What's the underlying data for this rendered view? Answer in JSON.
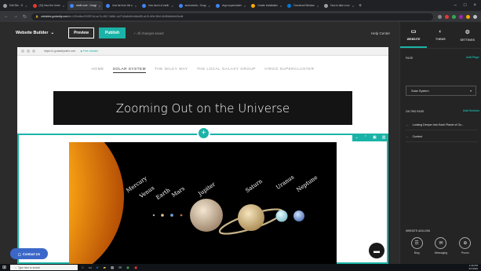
{
  "browser": {
    "tabs": [
      {
        "label": "Edit Site - G",
        "active": false
      },
      {
        "label": "(24) How the Unive",
        "active": false
      },
      {
        "label": "earth core - Googl",
        "active": true
      },
      {
        "label": "how far from the s",
        "active": false
      },
      {
        "label": "how much of earth",
        "active": false
      },
      {
        "label": "andromeda - Goog",
        "active": false
      },
      {
        "label": "virgo supercluster",
        "active": false
      },
      {
        "label": "Create Installation",
        "active": false
      },
      {
        "label": "Download Window",
        "active": false
      },
      {
        "label": "How to take a scr",
        "active": false
      }
    ],
    "url_host": "websites.godaddy.com",
    "url_path": "/en-US/editor/200f97c6-ac7b-4817-8d8e-1a27a3a4b6fc/b8cd85-a1f9-4f0e-9fe0-6f4f6b6d4eb5/edit"
  },
  "builder": {
    "brand_label": "Website Builder",
    "preview_label": "Preview",
    "publish_label": "Publish",
    "saved_label": "All changes saved",
    "help_label": "Help Center"
  },
  "panel": {
    "tabs": [
      {
        "label": "WEBSITE",
        "icon": "website-icon",
        "active": true
      },
      {
        "label": "THEME",
        "icon": "theme-icon",
        "active": false
      },
      {
        "label": "SETTINGS",
        "icon": "gear-icon",
        "active": false
      }
    ],
    "page_label": "PAGE",
    "add_page_label": "Add Page",
    "page_value": "Solar System",
    "on_this_page_label": "ON THIS PAGE",
    "add_section_label": "Add Section",
    "sections": [
      "Looking Deeper Into Each Planet of Ou...",
      "Content"
    ],
    "addons_label": "WEBSITE ADD-ONS",
    "addons": [
      {
        "label": "Blog",
        "icon": "blog-icon"
      },
      {
        "label": "Messaging",
        "icon": "messaging-icon"
      },
      {
        "label": "Promo",
        "icon": "promo-icon"
      }
    ]
  },
  "site": {
    "preview_url": "https://n.godaddysites.com",
    "free_domain_label": "Free domain",
    "nav": [
      "HOME",
      "SOLAR SYSTEM",
      "THE MILKY WAY",
      "THE LOCAL GALAXY GROUP",
      "VIRGO SUPERCLUSTER"
    ],
    "nav_active": "SOLAR SYSTEM",
    "hero_title": "Zooming Out on the Universe",
    "planets": [
      "Mercury",
      "Venus",
      "Earth",
      "Mars",
      "Jupiter",
      "Saturn",
      "Uranus",
      "Neptune"
    ],
    "contact_label": "Contact Us"
  },
  "taskbar": {
    "search_placeholder": "Type here to search",
    "time": "1:26 PM",
    "date": "3/7/2020"
  },
  "colors": {
    "accent": "#1bb3a7",
    "contact": "#3b67c8"
  }
}
